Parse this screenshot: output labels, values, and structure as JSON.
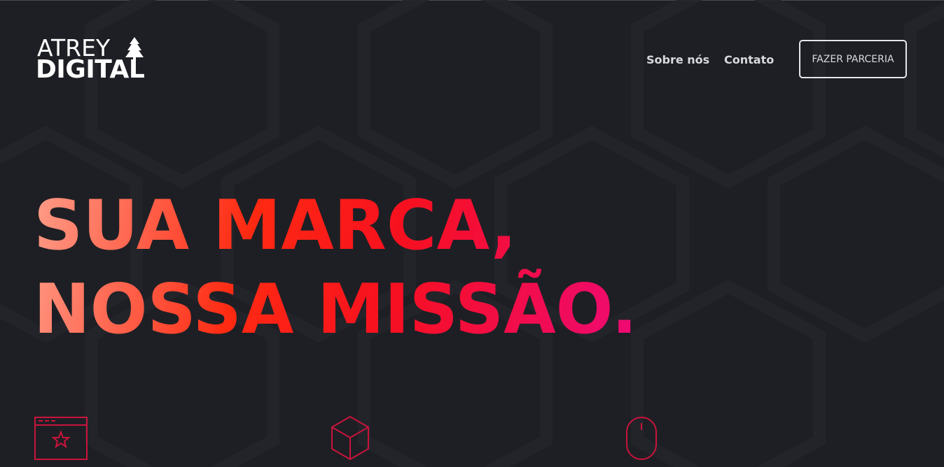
{
  "brand": {
    "line1": "ATREY",
    "line2": "DIGITAL"
  },
  "nav": {
    "items": [
      {
        "label": "Sobre nós"
      },
      {
        "label": "Contato"
      }
    ],
    "cta_label": "FAZER PARCERIA"
  },
  "hero": {
    "line1": "SUA MARCA,",
    "line2": "NOSSA MISSÃO."
  },
  "features": [
    {
      "icon": "browser-star-icon"
    },
    {
      "icon": "cube-icon"
    },
    {
      "icon": "mouse-icon"
    }
  ],
  "colors": {
    "background": "#1e1f24",
    "gradient_start": "#ff9b86",
    "gradient_mid": "#ff2a12",
    "gradient_end": "#ee0a72",
    "icon_stroke": "#c8143c"
  }
}
